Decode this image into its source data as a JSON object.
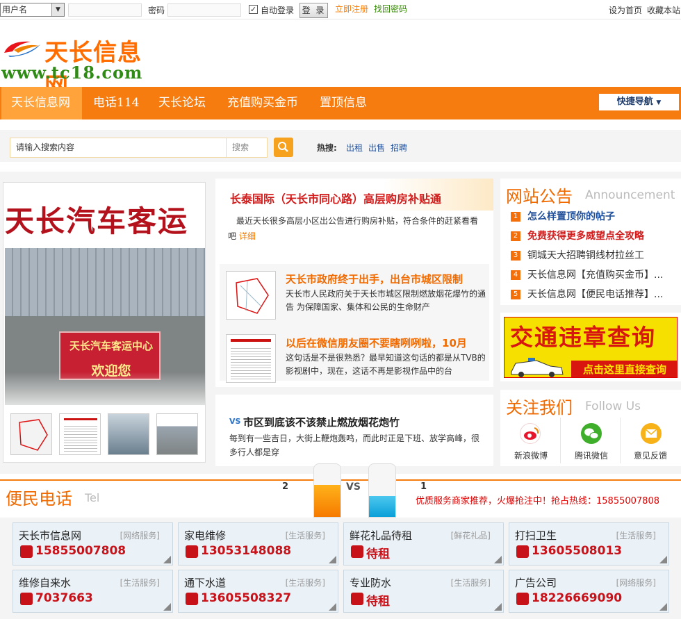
{
  "topbar": {
    "user_select": "用户名",
    "password_label": "密码",
    "auto_login": "自动登录",
    "login_button": "登 录",
    "register_link": "立即注册",
    "recover_link": "找回密码",
    "set_home": "设为首页",
    "bookmark": "收藏本站"
  },
  "logo": {
    "name": "天长信息网",
    "url": "www.tc18.com"
  },
  "nav": {
    "items": [
      "天长信息网",
      "电话114",
      "天长论坛",
      "充值购买金币",
      "置顶信息"
    ],
    "quick": "快捷导航"
  },
  "search": {
    "placeholder": "请输入搜索内容",
    "category": "搜索",
    "hot_label": "热搜:",
    "keywords": [
      "出租",
      "出售",
      "招聘"
    ]
  },
  "slide": {
    "sign_text": "天长汽车客运",
    "banner_text": "天长汽车客运中心",
    "banner_sub": "欢迎您"
  },
  "headline": {
    "title": "长泰国际（天长市同心路）高层购房补贴通",
    "desc": "最近天长很多高层小区出公告进行购房补贴，符合条件的赶紧看看吧",
    "more": "详细"
  },
  "news": [
    {
      "title": "天长市政府终于出手，出台市城区限制",
      "desc": "天长市人民政府关于天长市城区限制燃放烟花爆竹的通告 为保障国家、集体和公民的生命财产"
    },
    {
      "title": "以后在微信朋友圈不要瞎咧咧啦，10月",
      "desc": "这句话是不是很熟悉？最早知道这句话的都是从TVB的影视剧中，现在，这话不再是影视作品中的台"
    }
  ],
  "vs_news": {
    "tag": "VS",
    "title": "市区到底该不该禁止燃放烟花炮竹",
    "desc": "每到有一些吉日，大街上鞭炮轰鸣，而此时正是下班、放学高峰，很多行人都是穿"
  },
  "notice": {
    "title": "网站公告",
    "sub": "Announcement",
    "items": [
      {
        "num": "1",
        "text": "怎么样置顶你的帖子",
        "color": "#1f4f9a",
        "bold": true
      },
      {
        "num": "2",
        "text": "免费获得更多威望点全攻略",
        "color": "#d11c1c",
        "bold": true
      },
      {
        "num": "3",
        "text": "铜城天大招聘铜线材拉丝工",
        "color": "#333333",
        "bold": false
      },
      {
        "num": "4",
        "text": "天长信息网【充值购买金币】...",
        "color": "#333333",
        "bold": false
      },
      {
        "num": "5",
        "text": "天长信息网【便民电话推荐】...",
        "color": "#333333",
        "bold": false
      }
    ]
  },
  "traffic": {
    "title": "交通违章查询",
    "button": "点击这里直接查询"
  },
  "follow": {
    "title": "关注我们",
    "sub": "Follow Us",
    "items": [
      "新浪微博",
      "腾讯微信",
      "意见反馈"
    ]
  },
  "phone": {
    "title": "便民电话",
    "sub": "Tel",
    "ad": "优质服务商家推荐，火爆抢注中！抢占热线：15855007808",
    "vote_left": "2",
    "vote_right": "1",
    "vs": "VS",
    "cards": [
      {
        "name": "天长市信息网",
        "cat": "[网络服务]",
        "num": "15855007808"
      },
      {
        "name": "家电维修",
        "cat": "[生活服务]",
        "num": "13053148088"
      },
      {
        "name": "鲜花礼品待租",
        "cat": "[鲜花礼品]",
        "num": "待租"
      },
      {
        "name": "打扫卫生",
        "cat": "[生活服务]",
        "num": "13605508013"
      },
      {
        "name": "维修自来水",
        "cat": "[生活服务]",
        "num": "7037663"
      },
      {
        "name": "通下水道",
        "cat": "[生活服务]",
        "num": "13605508327"
      },
      {
        "name": "专业防水",
        "cat": "[生活服务]",
        "num": "待租"
      },
      {
        "name": "广告公司",
        "cat": "[网络服务]",
        "num": "18226669090"
      }
    ]
  },
  "colors": {
    "accent": "#f77c10",
    "red": "#d11c1c",
    "blue": "#1f4f9a",
    "green": "#2f8a16"
  }
}
